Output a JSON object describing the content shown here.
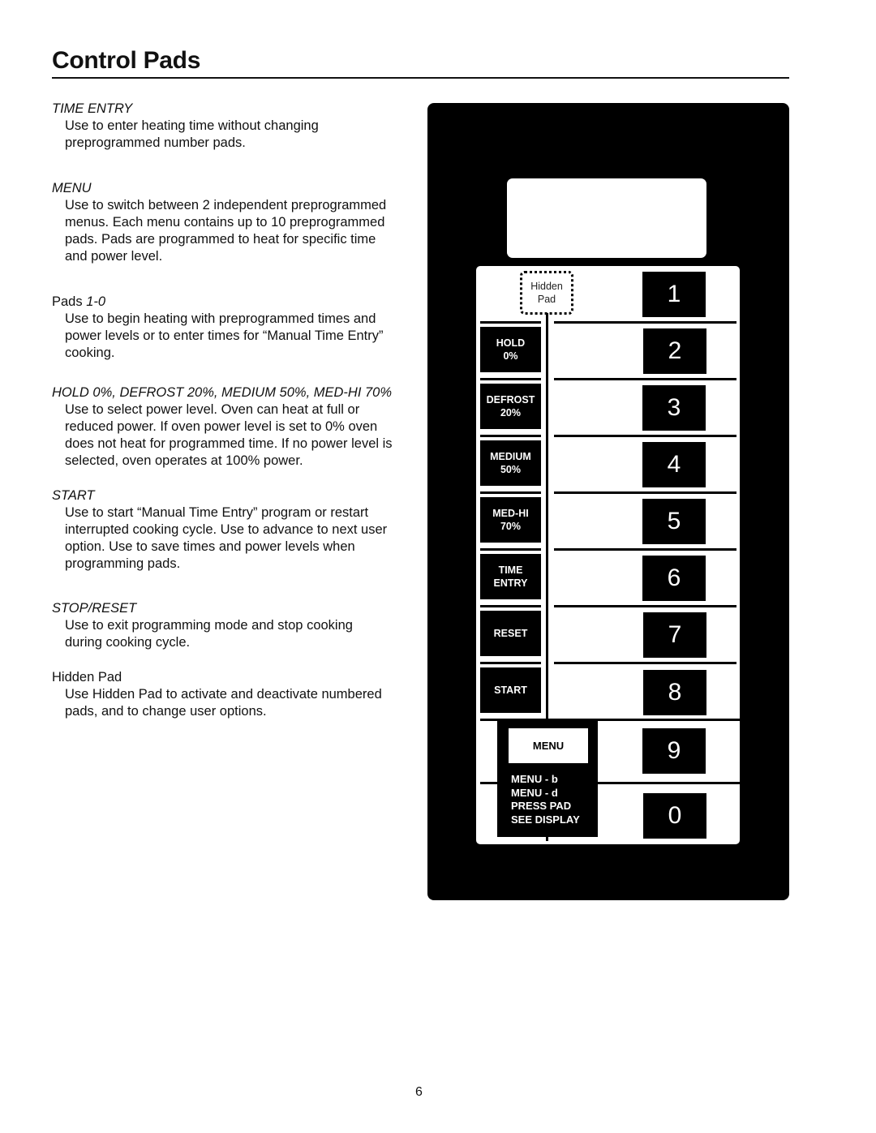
{
  "page": {
    "title": "Control Pads",
    "page_number": "6"
  },
  "sections": [
    {
      "heading": "TIME ENTRY",
      "heading_style": "italic",
      "body": [
        "Use to enter heating time without changing",
        "preprogrammed number pads."
      ]
    },
    {
      "heading": "MENU",
      "heading_style": "italic",
      "body": [
        "Use to switch between 2 independent preprogrammed",
        "menus. Each menu contains up to 10 preprogrammed",
        "pads. Pads are programmed to heat for specific time",
        "and power level."
      ]
    },
    {
      "heading_prefix": "Pads ",
      "heading_italic_part": "1-0",
      "body": [
        "Use to begin heating with preprogrammed times and",
        "power levels or to enter times for “Manual Time Entry”",
        "cooking."
      ]
    },
    {
      "heading": "HOLD 0%, DEFROST 20%, MEDIUM 50%, MED-HI 70%",
      "heading_style": "italic",
      "body": [
        "Use to select power level. Oven can heat at full or",
        "reduced power. If oven power level is set to 0% oven",
        "does not heat for programmed time. If no power level is",
        "selected, oven operates at 100% power."
      ]
    },
    {
      "heading": "START",
      "heading_style": "italic",
      "body": [
        "Use to start “Manual Time Entry” program or restart",
        "interrupted cooking cycle. Use to advance to next user",
        "option. Use to save times and power levels when",
        "programming pads."
      ]
    },
    {
      "heading": "STOP/RESET",
      "heading_style": "italic",
      "body": [
        "Use to exit programming mode and stop cooking",
        "during cooking cycle."
      ]
    },
    {
      "heading": "Hidden Pad",
      "heading_style": "normal",
      "body": [
        "Use Hidden Pad to activate and deactivate numbered",
        "pads, and to change user options."
      ]
    }
  ],
  "panel": {
    "hidden_pad": {
      "line1": "Hidden",
      "line2": "Pad"
    },
    "function_pads": [
      {
        "line1": "HOLD",
        "line2": "0%"
      },
      {
        "line1": "DEFROST",
        "line2": "20%"
      },
      {
        "line1": "MEDIUM",
        "line2": "50%"
      },
      {
        "line1": "MED-HI",
        "line2": "70%"
      },
      {
        "line1": "TIME",
        "line2": "ENTRY"
      },
      {
        "line1": "RESET",
        "line2": ""
      },
      {
        "line1": "START",
        "line2": ""
      }
    ],
    "number_pads": [
      "1",
      "2",
      "3",
      "4",
      "5",
      "6",
      "7",
      "8",
      "9",
      "0"
    ],
    "menu_button": "MENU",
    "menu_info": [
      "MENU - b",
      "MENU - d",
      "PRESS PAD",
      "SEE DISPLAY"
    ],
    "colors": {
      "panel": "#000000",
      "pad_area": "#ffffff",
      "pad": "#000000",
      "pad_text": "#ffffff"
    }
  }
}
